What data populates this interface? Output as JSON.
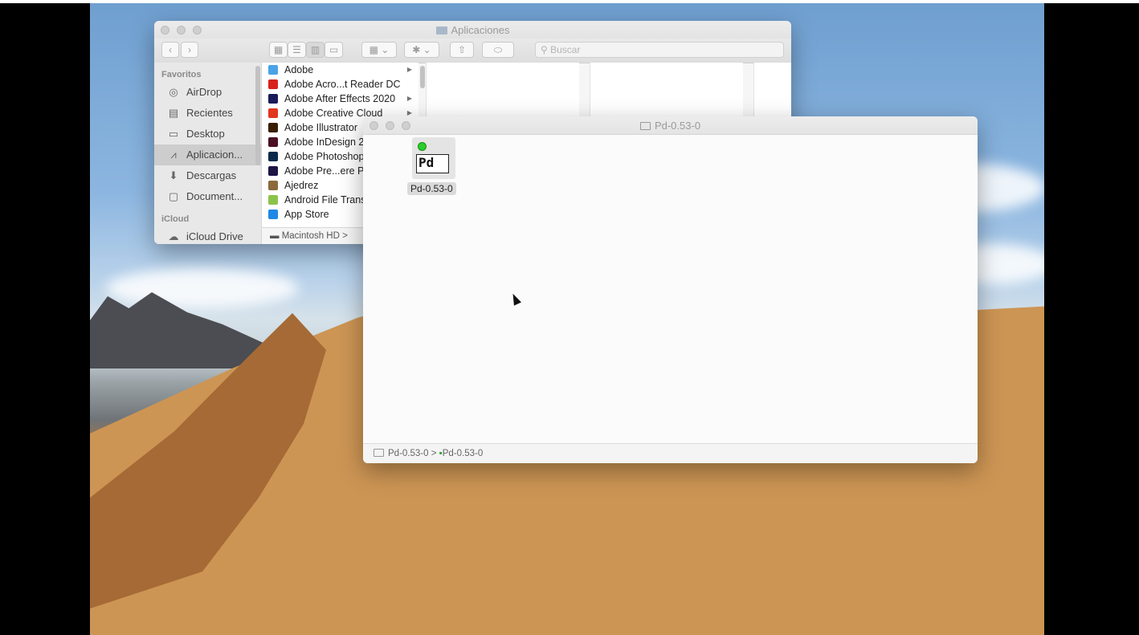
{
  "finder": {
    "title": "Aplicaciones",
    "search_placeholder": "Buscar",
    "sidebar": {
      "favorites_header": "Favoritos",
      "items": [
        {
          "label": "AirDrop",
          "icon": "airdrop-icon"
        },
        {
          "label": "Recientes",
          "icon": "recents-icon"
        },
        {
          "label": "Desktop",
          "icon": "desktop-icon"
        },
        {
          "label": "Aplicacion...",
          "icon": "applications-icon",
          "selected": true
        },
        {
          "label": "Descargas",
          "icon": "downloads-icon"
        },
        {
          "label": "Document...",
          "icon": "documents-icon"
        }
      ],
      "icloud_header": "iCloud",
      "icloud_items": [
        {
          "label": "iCloud Drive",
          "icon": "cloud-icon"
        }
      ]
    },
    "files": [
      {
        "name": "Adobe",
        "icon": "folder-icon",
        "color": "#4aa3e8",
        "has_children": true
      },
      {
        "name": "Adobe Acro...t Reader DC",
        "icon": "acrobat-icon",
        "color": "#d8231c",
        "has_children": false
      },
      {
        "name": "Adobe After Effects 2020",
        "icon": "aftereffects-icon",
        "color": "#1a1a5a",
        "has_children": true
      },
      {
        "name": "Adobe Creative Cloud",
        "icon": "creativecloud-icon",
        "color": "#e2351d",
        "has_children": true
      },
      {
        "name": "Adobe Illustrator",
        "icon": "illustrator-icon",
        "color": "#3a1d00",
        "has_children": false
      },
      {
        "name": "Adobe InDesign 2",
        "icon": "indesign-icon",
        "color": "#4b0f24",
        "has_children": false
      },
      {
        "name": "Adobe Photoshop",
        "icon": "photoshop-icon",
        "color": "#0b2a4a",
        "has_children": false
      },
      {
        "name": "Adobe Pre...ere P",
        "icon": "premiere-icon",
        "color": "#1e1446",
        "has_children": false
      },
      {
        "name": "Ajedrez",
        "icon": "chess-icon",
        "color": "#8b6a3a",
        "has_children": false
      },
      {
        "name": "Android File Trans",
        "icon": "android-icon",
        "color": "#8bc34a",
        "has_children": false
      },
      {
        "name": "App Store",
        "icon": "appstore-icon",
        "color": "#1e88e5",
        "has_children": false
      }
    ],
    "path": [
      "Macintosh HD",
      ">"
    ]
  },
  "pd_window": {
    "title": "Pd-0.53-0",
    "icon_label": "Pd-0.53-0",
    "icon_text": "Pd",
    "path": [
      "Pd-0.53-0",
      ">",
      "Pd-0.53-0"
    ]
  }
}
